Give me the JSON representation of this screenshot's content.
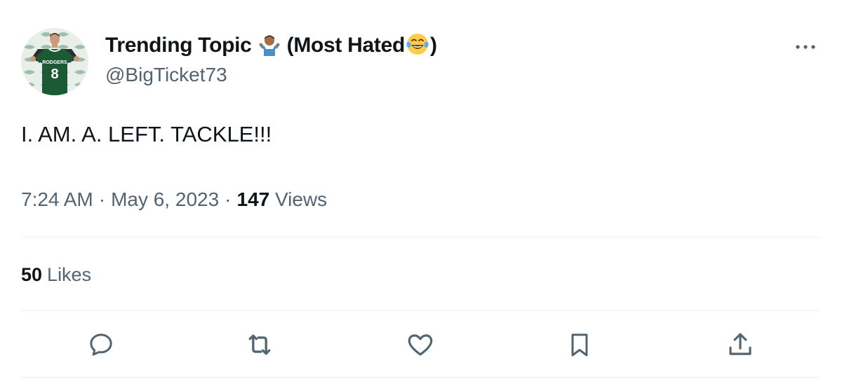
{
  "author": {
    "display_name_pre": "Trending Topic ",
    "emoji_1": "person-shrugging-emoji",
    "display_name_mid": " (Most Hated",
    "emoji_2": "face-with-tears-of-joy-emoji",
    "display_name_post": ")",
    "handle": "@BigTicket73",
    "avatar_jersey_name": "RODGERS",
    "avatar_jersey_number": "8"
  },
  "tweet": {
    "text": "I. AM. A. LEFT. TACKLE!!!",
    "time": "7:24 AM",
    "date": "May 6, 2023",
    "separator": "·",
    "views_count": "147",
    "views_label": "Views"
  },
  "stats": {
    "likes_count": "50",
    "likes_label": "Likes"
  },
  "actions": {
    "reply_icon": "reply-icon",
    "retweet_icon": "retweet-icon",
    "like_icon": "heart-icon",
    "bookmark_icon": "bookmark-icon",
    "share_icon": "share-icon"
  },
  "colors": {
    "text_primary": "#0f1419",
    "text_secondary": "#536471",
    "divider": "#eff3f4",
    "jersey_green": "#1c5a36"
  }
}
